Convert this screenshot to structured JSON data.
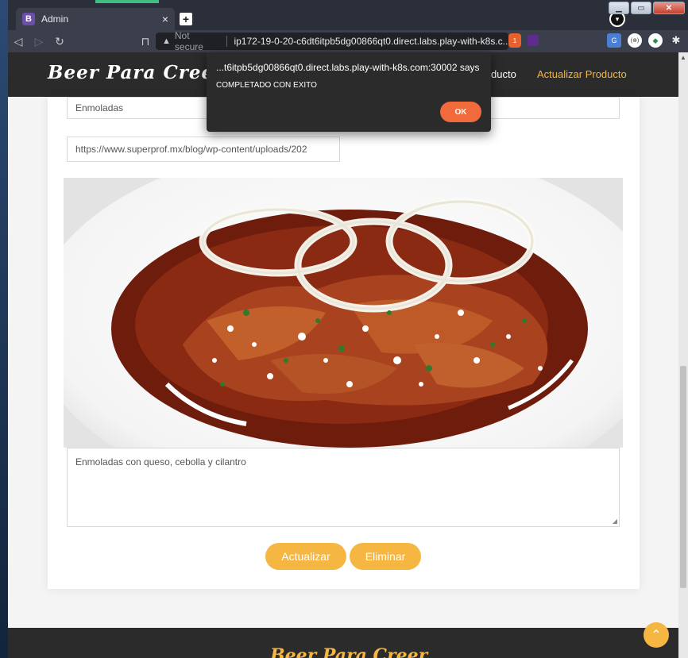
{
  "browser": {
    "tab_title": "Admin",
    "tab_favicon": "B",
    "tab_close": "×",
    "new_tab": "+",
    "security_label": "Not secure",
    "url": "ip172-19-0-20-c6dt6itpb5dg00866qt0.direct.labs.play-with-k8s.c...",
    "brave_badge_count": "1",
    "extension_label": "(⊕)"
  },
  "site": {
    "logo": "Beer Para Creer",
    "nav_partial": "ducto",
    "nav_active": "Actualizar Producto",
    "accent_color": "#f5b642"
  },
  "form": {
    "name_value": "Enmoladas",
    "image_url_value": "https://www.superprof.mx/blog/wp-content/uploads/202",
    "description_value": "Enmoladas con queso, cebolla y cilantro",
    "update_label": "Actualizar",
    "delete_label": "Eliminar"
  },
  "footer": {
    "logo": "Beer Para Creer"
  },
  "dialog": {
    "title": "...t6itpb5dg00866qt0.direct.labs.play-with-k8s.com:30002 says",
    "message": "COMPLETADO CON EXITO",
    "ok_label": "OK"
  }
}
